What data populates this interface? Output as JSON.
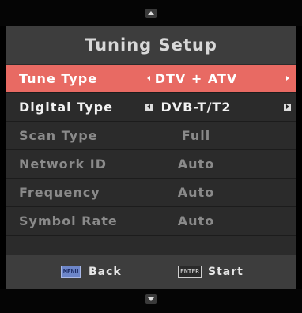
{
  "title": "Tuning Setup",
  "rows": [
    {
      "label": "Tune Type",
      "value": "DTV + ATV"
    },
    {
      "label": "Digital Type",
      "value": "DVB-T/T2"
    },
    {
      "label": "Scan Type",
      "value": "Full"
    },
    {
      "label": "Network ID",
      "value": "Auto"
    },
    {
      "label": "Frequency",
      "value": "Auto"
    },
    {
      "label": "Symbol Rate",
      "value": "Auto"
    }
  ],
  "footer": {
    "menu_key": "MENU",
    "back_label": "Back",
    "enter_key": "ENTER",
    "start_label": "Start"
  },
  "colors": {
    "selected_row": "#e86a63",
    "panel": "#2b2b2b",
    "title_bar": "#3d3d3d"
  },
  "icons": {
    "scroll_up": "triangle-up",
    "scroll_down": "triangle-down",
    "value_left": "triangle-left",
    "value_right": "triangle-right"
  }
}
